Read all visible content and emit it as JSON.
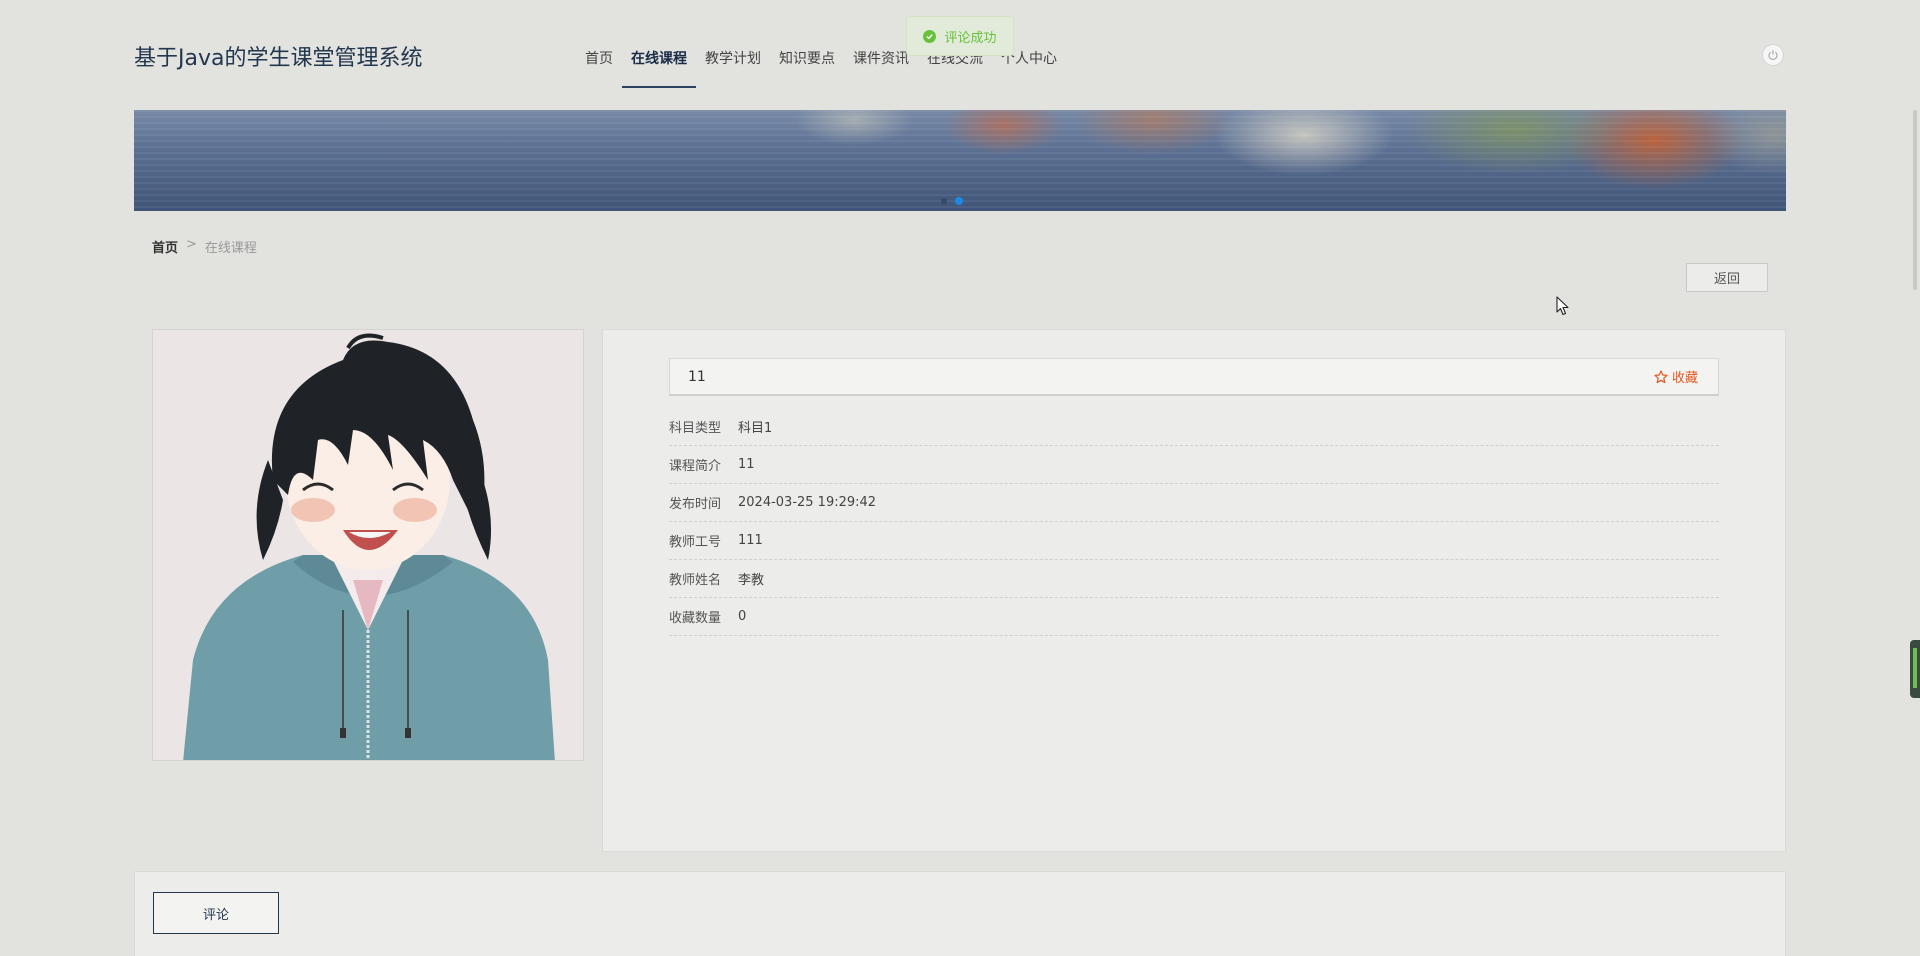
{
  "header": {
    "site_title": "基于Java的学生课堂管理系统",
    "nav": [
      {
        "label": "首页",
        "active": false
      },
      {
        "label": "在线课程",
        "active": true
      },
      {
        "label": "教学计划",
        "active": false
      },
      {
        "label": "知识要点",
        "active": false
      },
      {
        "label": "课件资讯",
        "active": false
      },
      {
        "label": "在线交流",
        "active": false
      },
      {
        "label": "个人中心",
        "active": false
      }
    ]
  },
  "toast": {
    "message": "评论成功",
    "color": "#67c23a"
  },
  "breadcrumb": {
    "home": "首页",
    "separator": ">",
    "current": "在线课程"
  },
  "actions": {
    "back_label": "返回",
    "comment_label": "评论"
  },
  "course": {
    "title": "11",
    "favorite_label": "收藏",
    "fields": [
      {
        "label": "科目类型",
        "value": "科目1"
      },
      {
        "label": "课程简介",
        "value": "11"
      },
      {
        "label": "发布时间",
        "value": "2024-03-25 19:29:42"
      },
      {
        "label": "教师工号",
        "value": "111"
      },
      {
        "label": "教师姓名",
        "value": "李教"
      },
      {
        "label": "收藏数量",
        "value": "0"
      }
    ]
  },
  "colors": {
    "accent": "#23374f",
    "favorite": "#e4571f",
    "success": "#67c23a"
  }
}
